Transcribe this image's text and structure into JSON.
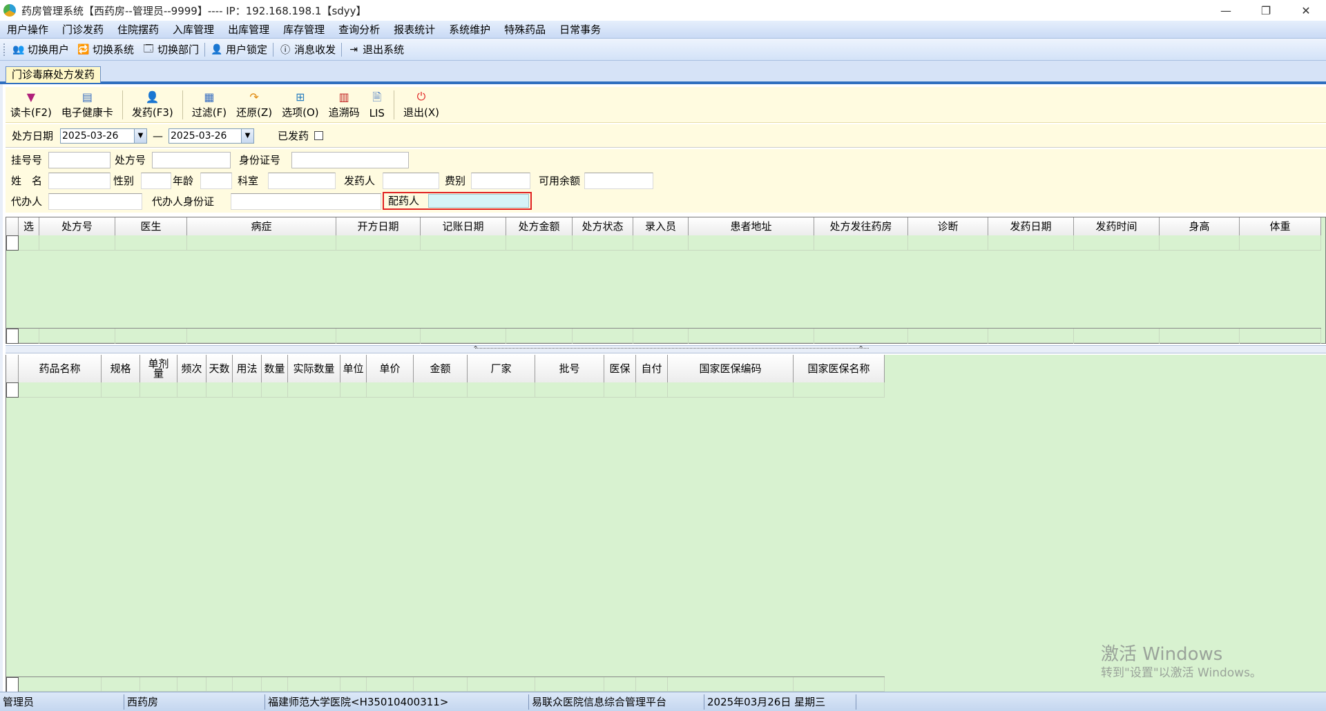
{
  "window": {
    "title": "药房管理系统【西药房--管理员--9999】---- IP：192.168.198.1【sdyy】",
    "minimize": "—",
    "maximize": "❐",
    "close": "✕"
  },
  "menu": [
    "用户操作",
    "门诊发药",
    "住院摆药",
    "入库管理",
    "出库管理",
    "库存管理",
    "查询分析",
    "报表统计",
    "系统维护",
    "特殊药品",
    "日常事务"
  ],
  "toolbar": [
    {
      "label": "切换用户",
      "icon": "switch-user-icon"
    },
    {
      "label": "切换系统",
      "icon": "switch-system-icon"
    },
    {
      "label": "切换部门",
      "icon": "switch-department-icon"
    },
    {
      "label": "用户锁定",
      "icon": "user-lock-icon"
    },
    {
      "label": "消息收发",
      "icon": "info-icon"
    },
    {
      "label": "退出系统",
      "icon": "exit-icon"
    }
  ],
  "tab": {
    "label": "门诊毒麻处方发药"
  },
  "ribbon": [
    {
      "label": "读卡(F2)",
      "icon": "card-reader-icon"
    },
    {
      "label": "电子健康卡",
      "icon": "health-card-icon"
    },
    {
      "label": "发药(F3)",
      "icon": "dispense-icon"
    },
    {
      "label": "过滤(F)",
      "icon": "filter-icon"
    },
    {
      "label": "还原(Z)",
      "icon": "restore-icon"
    },
    {
      "label": "选项(O)",
      "icon": "options-icon"
    },
    {
      "label": "追溯码",
      "icon": "barcode-icon"
    },
    {
      "label": "LIS",
      "icon": "lis-icon"
    },
    {
      "label": "退出(X)",
      "icon": "power-icon"
    }
  ],
  "filter": {
    "date_label": "处方日期",
    "date_from": "2025-03-26",
    "dash": "—",
    "date_to": "2025-03-26",
    "dispensed_label": "已发药"
  },
  "form": {
    "reg_no": "挂号号",
    "rx_no": "处方号",
    "id_no": "身份证号",
    "name": "姓　名",
    "gender": "性别",
    "age": "年龄",
    "dept": "科室",
    "dispenser": "发药人",
    "fee_type": "费别",
    "balance": "可用余额",
    "agent": "代办人",
    "agent_id": "代办人身份证",
    "preparer": "配药人"
  },
  "grid1": {
    "columns": [
      "选",
      "处方号",
      "医生",
      "病症",
      "开方日期",
      "记账日期",
      "处方金额",
      "处方状态",
      "录入员",
      "患者地址",
      "处方发往药房",
      "诊断",
      "发药日期",
      "发药时间",
      "身高",
      "体重"
    ]
  },
  "grid2": {
    "columns": [
      "药品名称",
      "规格",
      "单剂\n量",
      "频次",
      "天数",
      "用法",
      "数量",
      "实际数量",
      "单位",
      "单价",
      "金额",
      "厂家",
      "批号",
      "医保",
      "自付",
      "国家医保编码",
      "国家医保名称"
    ]
  },
  "statusbar": [
    "管理员",
    "西药房",
    "福建师范大学医院<H35010400311>",
    "易联众医院信息综合管理平台",
    "2025年03月26日 星期三",
    ""
  ],
  "watermark": {
    "line1": "激活 Windows",
    "line2": "转到\"设置\"以激活 Windows。"
  }
}
